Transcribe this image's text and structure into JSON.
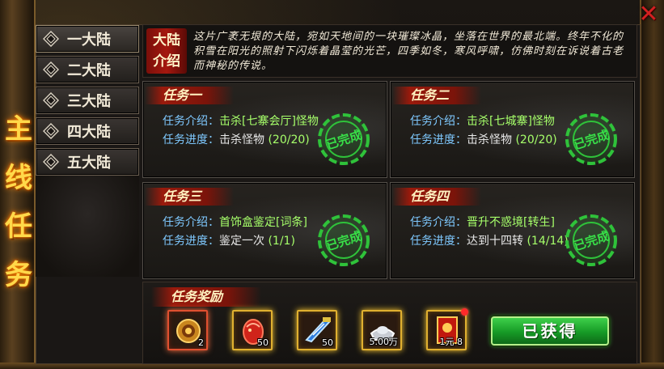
{
  "window": {
    "title_vertical": [
      "主",
      "线",
      "任",
      "务"
    ],
    "close_glyph": "✕"
  },
  "continents": [
    {
      "label": "一大陆",
      "active": true
    },
    {
      "label": "二大陆",
      "active": false
    },
    {
      "label": "三大陆",
      "active": false
    },
    {
      "label": "四大陆",
      "active": false
    },
    {
      "label": "五大陆",
      "active": false
    }
  ],
  "intro": {
    "badge_line1": "大陆",
    "badge_line2": "介绍",
    "text": "这片广袤无垠的大陆，宛如天地间的一块璀璨冰晶，坐落在世界的最北端。终年不化的积雪在阳光的照射下闪烁着晶莹的光芒，四季如冬，寒风呼啸，仿佛时刻在诉说着古老而神秘的传说。"
  },
  "tasks": [
    {
      "title": "任务一",
      "intro_label": "任务介绍：",
      "intro_value": "击杀[七寨会厅]怪物",
      "progress_label": "任务进度：",
      "progress_text": "击杀怪物",
      "progress_value": "(20/20)",
      "stamp": "已完成"
    },
    {
      "title": "任务二",
      "intro_label": "任务介绍：",
      "intro_value": "击杀[七城寨]怪物",
      "progress_label": "任务进度：",
      "progress_text": "击杀怪物",
      "progress_value": "(20/20)",
      "stamp": "已完成"
    },
    {
      "title": "任务三",
      "intro_label": "任务介绍：",
      "intro_value": "首饰盒鉴定[词条]",
      "progress_label": "任务进度：",
      "progress_text": "鉴定一次",
      "progress_value": "(1/1)",
      "stamp": "已完成"
    },
    {
      "title": "任务四",
      "intro_label": "任务介绍：",
      "intro_value": "晋升不惑境[转生]",
      "progress_label": "任务进度：",
      "progress_text": "达到十四转",
      "progress_value": "(14/14)",
      "stamp": "已完成"
    }
  ],
  "reward": {
    "title": "任务奖励",
    "items": [
      {
        "icon": "gold-coin-pouch-icon",
        "qty": "2",
        "frame": "red"
      },
      {
        "icon": "red-dragon-egg-icon",
        "qty": "50",
        "frame": "gold"
      },
      {
        "icon": "blue-wing-feather-icon",
        "qty": "50",
        "frame": "gold"
      },
      {
        "icon": "silver-ingot-icon",
        "qty": "5.00万",
        "frame": "gold"
      },
      {
        "icon": "red-envelope-icon",
        "qty": "1元 8",
        "frame": "gold"
      }
    ],
    "claimed_label": "已获得"
  },
  "colors": {
    "title_gold": "#ffd94a",
    "label_blue": "#7fc9ff",
    "value_green": "#a6ff6a",
    "stamp_green": "#2fc23a",
    "button_green": "#169a26",
    "badge_red": "#a5180f"
  }
}
